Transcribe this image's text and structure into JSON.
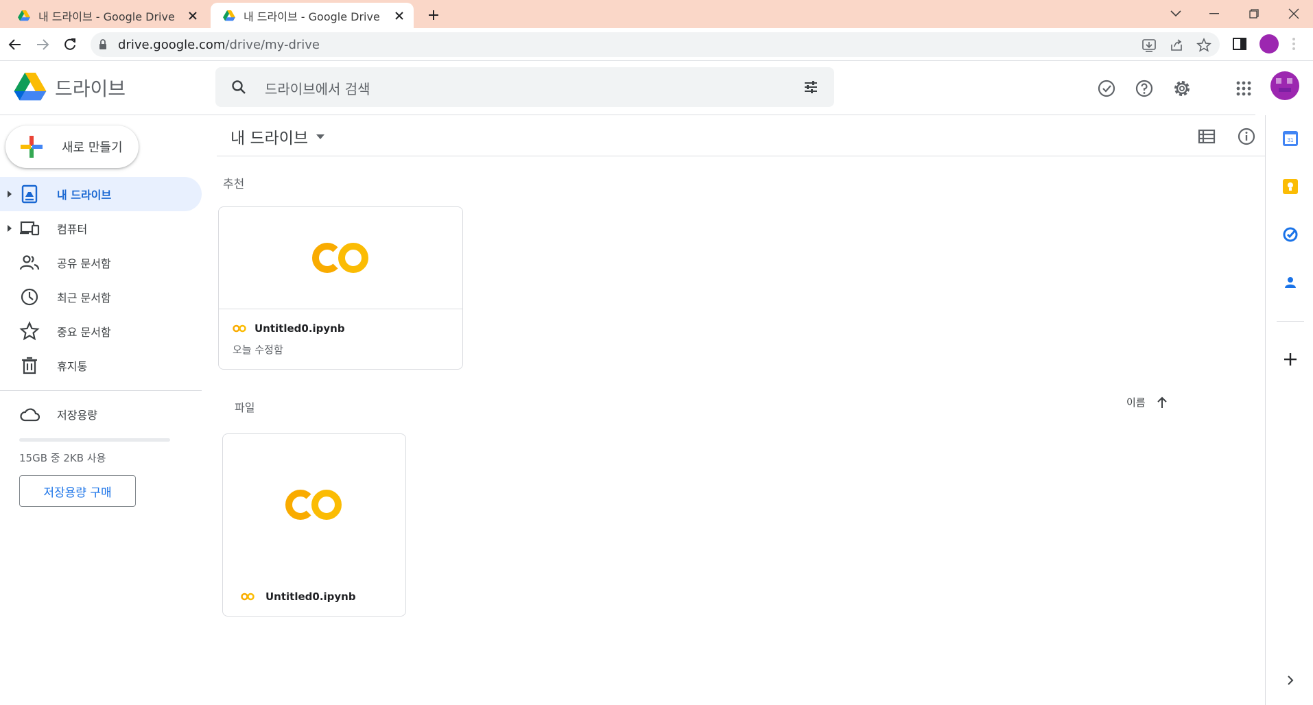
{
  "browser": {
    "tabs": [
      {
        "title": "내 드라이브 - Google Drive",
        "active": false
      },
      {
        "title": "내 드라이브 - Google Drive",
        "active": true
      }
    ],
    "url_host": "drive.google.com",
    "url_path": "/drive/my-drive"
  },
  "header": {
    "brand": "드라이브",
    "search_placeholder": "드라이브에서 검색"
  },
  "sidebar": {
    "new_button": "새로 만들기",
    "items": [
      {
        "label": "내 드라이브",
        "icon": "my-drive-icon",
        "active": true
      },
      {
        "label": "컴퓨터",
        "icon": "computers-icon",
        "active": false
      },
      {
        "label": "공유 문서함",
        "icon": "shared-icon",
        "active": false
      },
      {
        "label": "최근 문서함",
        "icon": "clock-icon",
        "active": false
      },
      {
        "label": "중요 문서함",
        "icon": "star-icon",
        "active": false
      },
      {
        "label": "휴지통",
        "icon": "trash-icon",
        "active": false
      }
    ],
    "storage_label": "저장용량",
    "storage_used_fraction": 0.0,
    "storage_text": "15GB 중 2KB 사용",
    "buy_storage": "저장용량 구매"
  },
  "main": {
    "title": "내 드라이브",
    "suggested_label": "추천",
    "suggested": [
      {
        "name": "Untitled0.ipynb",
        "subtitle": "오늘 수정함",
        "icon": "colab-icon"
      }
    ],
    "files_label": "파일",
    "sort_label": "이름",
    "files": [
      {
        "name": "Untitled0.ipynb",
        "icon": "colab-icon"
      }
    ]
  },
  "colors": {
    "accent": "#1a73e8",
    "active_bg": "#e8f0fe",
    "tabbar": "#fad7c8",
    "colab_dark": "#f9ab00",
    "colab_light": "#fbbc04"
  }
}
